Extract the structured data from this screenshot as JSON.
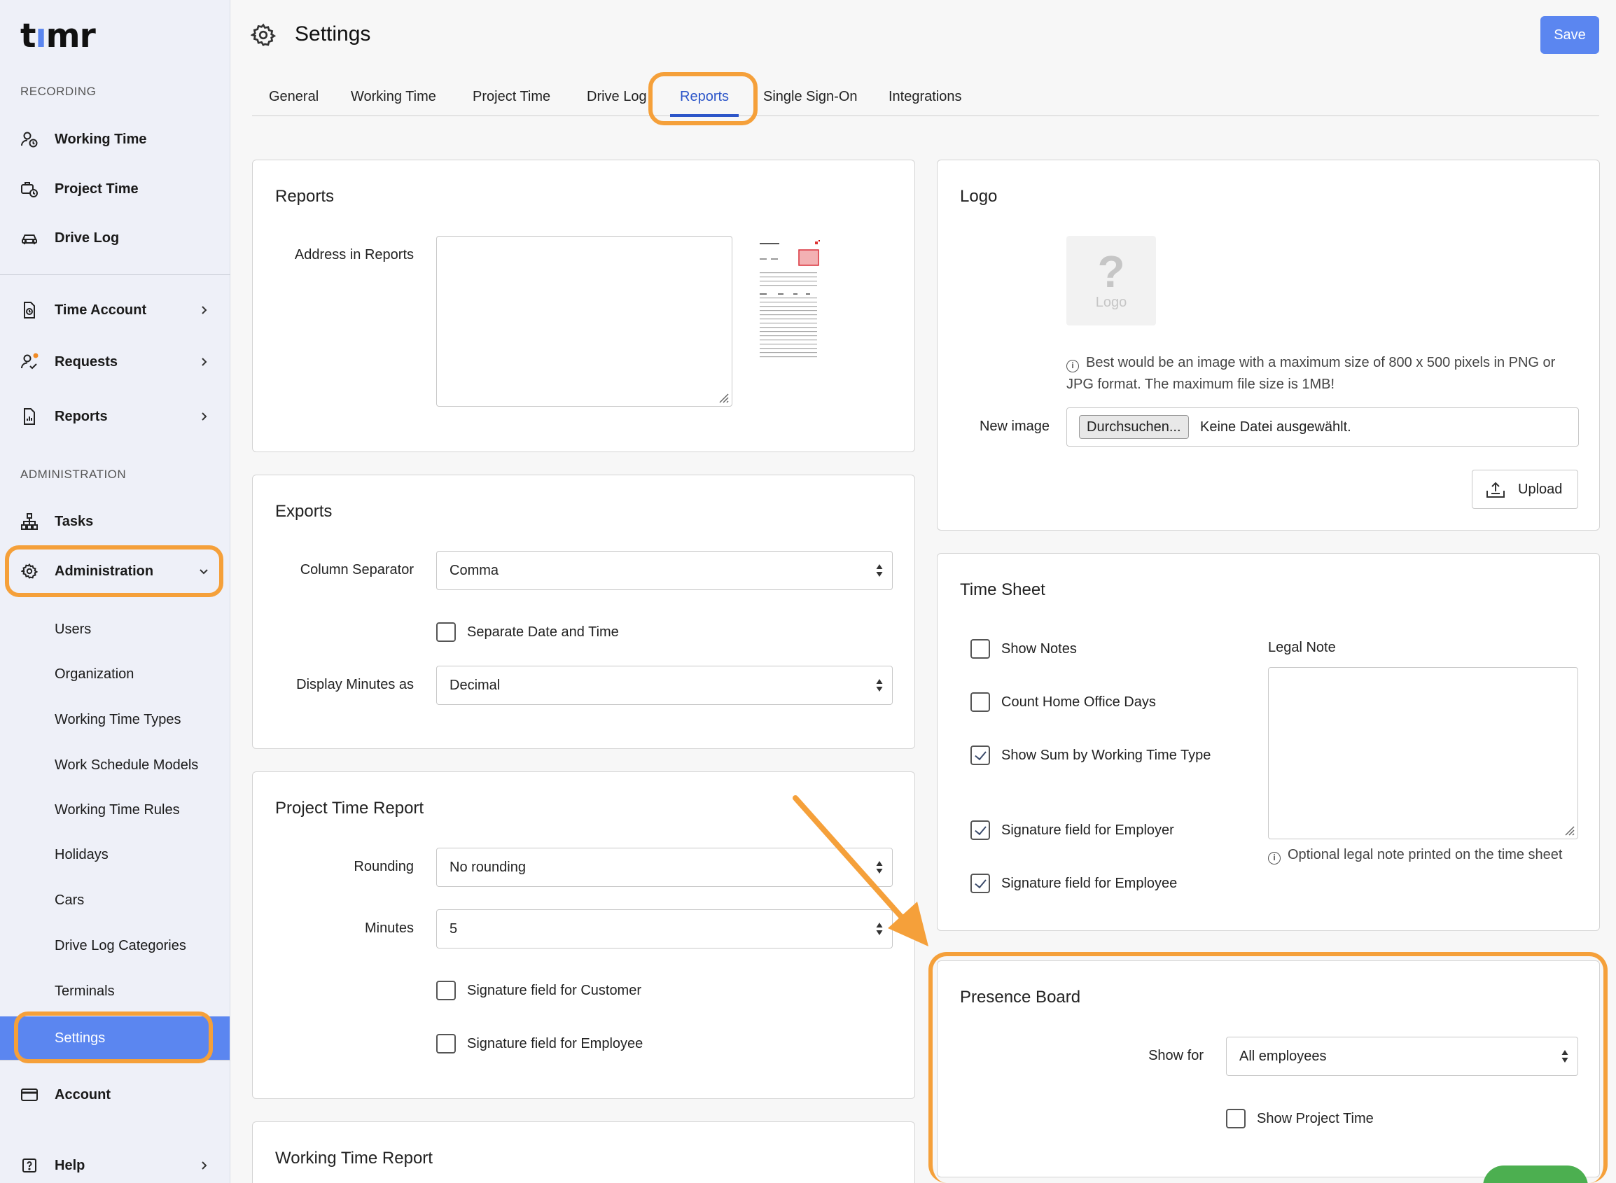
{
  "app": {
    "logo": "timr"
  },
  "sidebar": {
    "recording_title": "RECORDING",
    "recording_items": [
      {
        "label": "Working Time",
        "icon": "user-clock-icon"
      },
      {
        "label": "Project Time",
        "icon": "briefcase-clock-icon"
      },
      {
        "label": "Drive Log",
        "icon": "car-icon"
      }
    ],
    "middle_items": [
      {
        "label": "Time Account",
        "icon": "document-clock-icon"
      },
      {
        "label": "Requests",
        "icon": "user-check-icon"
      },
      {
        "label": "Reports",
        "icon": "report-icon"
      }
    ],
    "admin_title": "ADMINISTRATION",
    "tasks_label": "Tasks",
    "administration_label": "Administration",
    "admin_sub_items": [
      "Users",
      "Organization",
      "Working Time Types",
      "Work Schedule Models",
      "Working Time Rules",
      "Holidays",
      "Cars",
      "Drive Log Categories",
      "Terminals",
      "Settings"
    ],
    "account_label": "Account",
    "help_label": "Help"
  },
  "header": {
    "title": "Settings",
    "save_label": "Save"
  },
  "tabs": [
    "General",
    "Working Time",
    "Project Time",
    "Drive Log",
    "Reports",
    "Single Sign-On",
    "Integrations"
  ],
  "active_tab": "Reports",
  "reports_card": {
    "title": "Reports",
    "address_label": "Address in Reports",
    "address_value": ""
  },
  "exports_card": {
    "title": "Exports",
    "column_separator_label": "Column Separator",
    "column_separator_value": "Comma",
    "separate_date_time_label": "Separate Date and Time",
    "separate_date_time_checked": false,
    "display_minutes_label": "Display Minutes as",
    "display_minutes_value": "Decimal"
  },
  "project_time_report": {
    "title": "Project Time Report",
    "rounding_label": "Rounding",
    "rounding_value": "No rounding",
    "minutes_label": "Minutes",
    "minutes_value": "5",
    "sig_customer_label": "Signature field for Customer",
    "sig_employee_label": "Signature field for Employee"
  },
  "working_time_report": {
    "title": "Working Time Report"
  },
  "logo_card": {
    "title": "Logo",
    "placeholder_text": "Logo",
    "placeholder_mark": "?",
    "info_text": "Best would be an image with a maximum size of 800 x 500 pixels in PNG or JPG format. The maximum file size is 1MB!",
    "new_image_label": "New image",
    "browse_label": "Durchsuchen...",
    "no_file_label": "Keine Datei ausgewählt.",
    "upload_label": "Upload"
  },
  "time_sheet": {
    "title": "Time Sheet",
    "checks": [
      {
        "label": "Show Notes",
        "checked": false
      },
      {
        "label": "Count Home Office Days",
        "checked": false
      },
      {
        "label": "Show Sum by Working Time Type",
        "checked": true
      },
      {
        "label": "Signature field for Employer",
        "checked": true
      },
      {
        "label": "Signature field for Employee",
        "checked": true
      }
    ],
    "legal_note_label": "Legal Note",
    "legal_note_value": "",
    "legal_note_hint": "Optional legal note printed on the time sheet"
  },
  "presence_board": {
    "title": "Presence Board",
    "show_for_label": "Show for",
    "show_for_value": "All employees",
    "show_project_time_label": "Show Project Time",
    "show_project_time_checked": false
  },
  "colors": {
    "accent": "#5b86f0",
    "highlight": "#f5a03a",
    "tab_active": "#2d56c9"
  }
}
